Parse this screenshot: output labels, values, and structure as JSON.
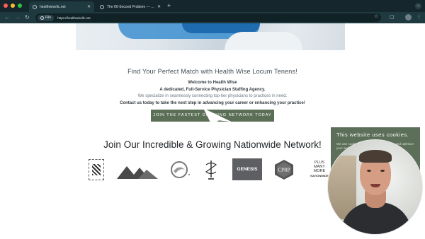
{
  "browser": {
    "tabs": [
      {
        "title": "healthwisellc.net",
        "active": true
      },
      {
        "title": "The 60-Second Problem — …",
        "active": false
      }
    ],
    "new_tab": "+",
    "omnibox": {
      "chip": "File",
      "url": "https://healthwisellc.net"
    },
    "icons": [
      "back-icon",
      "forward-icon",
      "reload-icon",
      "star-icon",
      "extensions-icon",
      "profile-icon",
      "menu-icon"
    ]
  },
  "page": {
    "headline": "Find Your Perfect Match with Health Wise Locum Tenens!",
    "intro": {
      "welcome": "Welcome to Health Wise",
      "tagline": "A dedicated, Full-Service Physician Staffing Agency.",
      "specialize": "We specialize in seamlessly connecting top-tier physicians to practices in need.",
      "contact": "Contact us today to take the next step in advancing your career or enhancing your practice!"
    },
    "cta_label": "JOIN THE FASTEST GROWING NETWORK TODAY",
    "network_title": "Join Our Incredible & Growing Nationwide Network!",
    "logos": {
      "genesis": "GENESIS",
      "cprp": "CPRP",
      "plus_many_more": [
        "PLUS",
        "MANY",
        "MORE"
      ],
      "nationwide": "NATIONWIDE"
    }
  },
  "cookie_banner": {
    "title": "This website uses cookies.",
    "text": "We use cookies to analyze website traffic and optimize your website experience."
  },
  "colors": {
    "chrome_dark": "#16262d",
    "chrome_toolbar": "#1e3a40",
    "cta_green": "#5b6e56",
    "cookie_green": "#5c6f58"
  }
}
